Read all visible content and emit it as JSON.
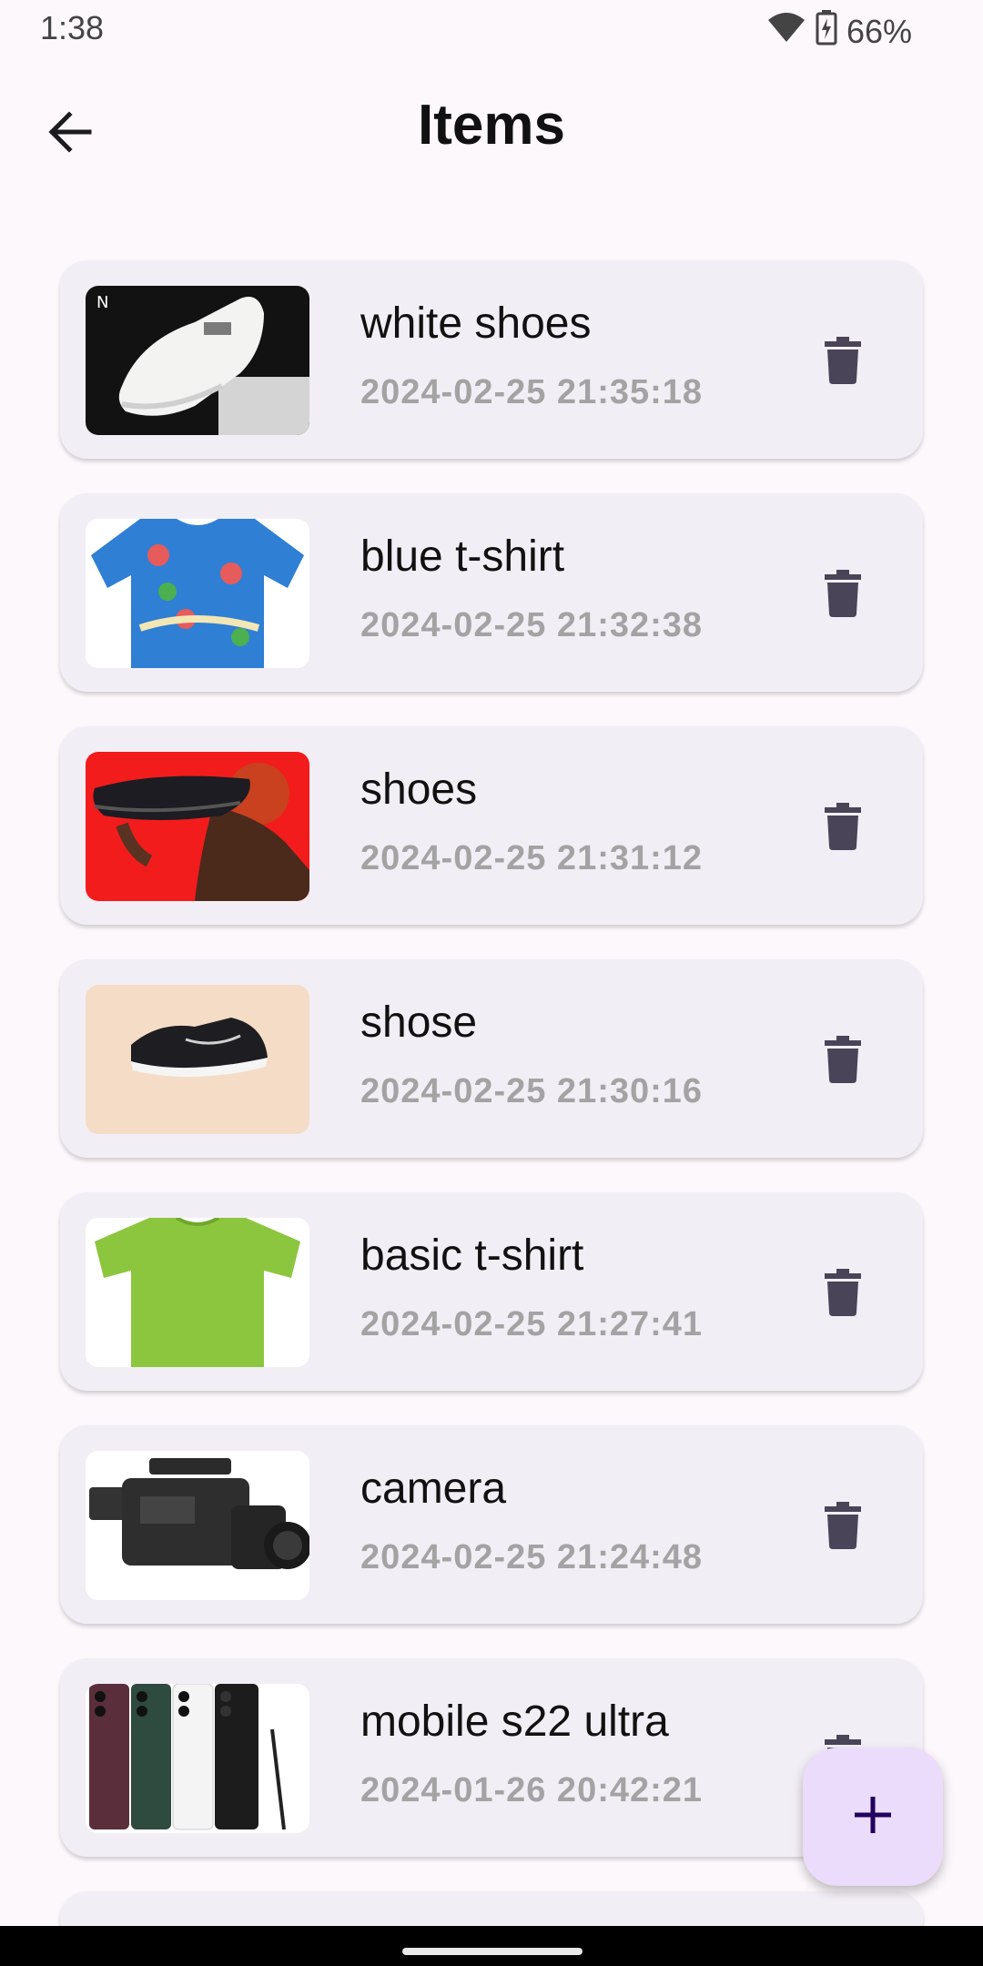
{
  "status": {
    "time": "1:38",
    "battery": "66%"
  },
  "header": {
    "title": "Items"
  },
  "items": [
    {
      "name": "white shoes",
      "date": "2024-02-25 21:35:18"
    },
    {
      "name": "blue t-shirt",
      "date": "2024-02-25 21:32:38"
    },
    {
      "name": "shoes",
      "date": "2024-02-25 21:31:12"
    },
    {
      "name": "shose",
      "date": "2024-02-25 21:30:16"
    },
    {
      "name": "basic t-shirt",
      "date": "2024-02-25 21:27:41"
    },
    {
      "name": "camera",
      "date": "2024-02-25 21:24:48"
    },
    {
      "name": "mobile s22 ultra",
      "date": "2024-01-26 20:42:21"
    }
  ],
  "icons": {
    "back": "arrow-left-icon",
    "delete": "trash-icon",
    "add": "plus-icon",
    "wifi": "wifi-icon",
    "battery": "battery-icon"
  },
  "colors": {
    "background": "#fdf8fc",
    "card": "#f2eef5",
    "date_text": "#a3a3a3",
    "fab": "#ebdcfb",
    "fab_icon": "#21005d",
    "delete_icon": "#4a4458"
  }
}
